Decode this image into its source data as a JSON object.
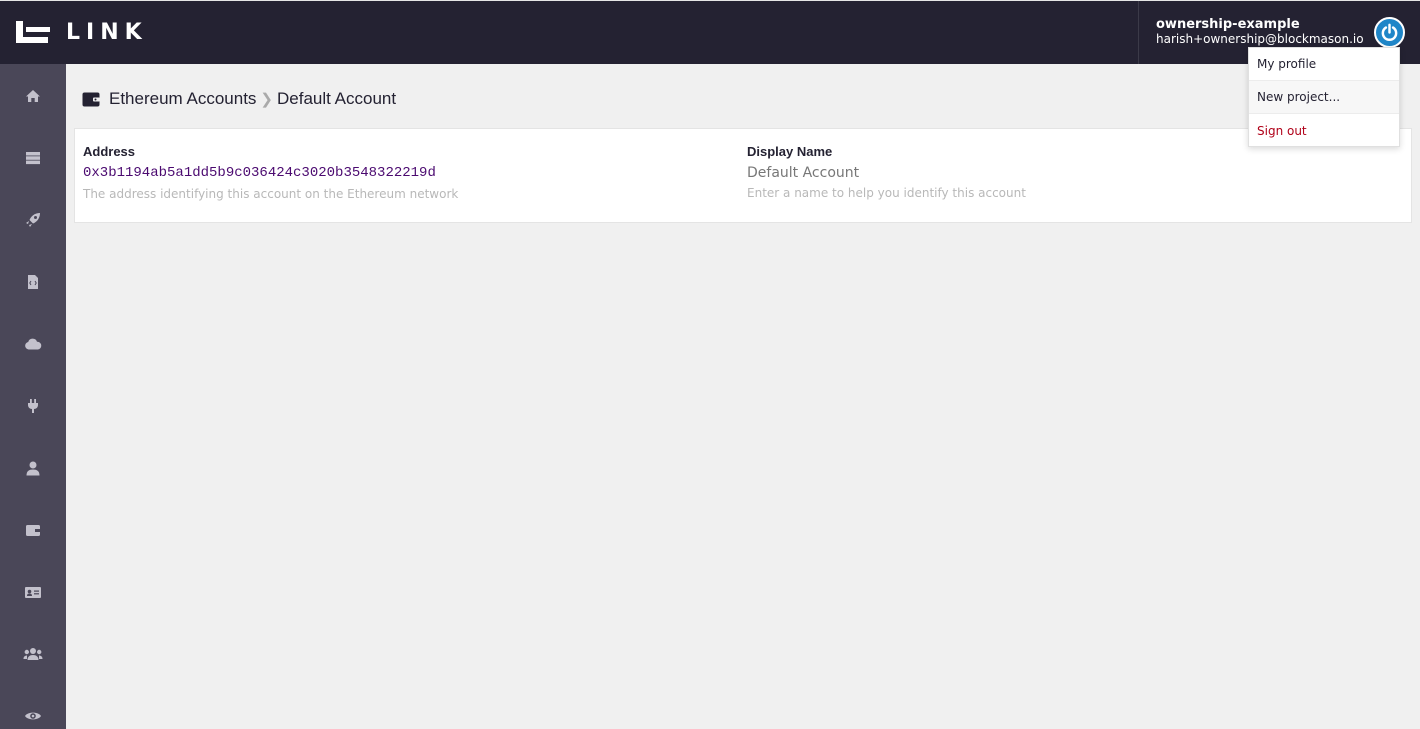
{
  "app": {
    "logo_text": "LINK"
  },
  "user": {
    "project": "ownership-example",
    "email": "harish+ownership@blockmason.io"
  },
  "sidebar": {
    "items": [
      {
        "icon": "home-icon"
      },
      {
        "icon": "server-icon"
      },
      {
        "icon": "rocket-icon"
      },
      {
        "icon": "file-code-icon"
      },
      {
        "icon": "cloud-icon"
      },
      {
        "icon": "plug-icon"
      },
      {
        "icon": "user-icon"
      },
      {
        "icon": "wallet-icon"
      },
      {
        "icon": "id-card-icon"
      },
      {
        "icon": "users-icon"
      },
      {
        "icon": "eye-icon"
      }
    ]
  },
  "breadcrumb": {
    "parent": "Ethereum Accounts",
    "separator": "❯",
    "current": "Default Account"
  },
  "account": {
    "address_label": "Address",
    "address_value": "0x3b1194ab5a1dd5b9c036424c3020b3548322219d",
    "address_help": "The address identifying this account on the Ethereum network",
    "display_name_label": "Display Name",
    "display_name_value": "Default Account",
    "display_name_help": "Enter a name to help you identify this account"
  },
  "menu": {
    "items": [
      {
        "label": "My profile"
      },
      {
        "label": "New project..."
      },
      {
        "label": "Sign out"
      }
    ]
  },
  "colors": {
    "topbar": "#242232",
    "sidebar": "#4a4758",
    "accent": "#1f86c8",
    "address": "#4b0a70",
    "danger": "#b00018"
  }
}
